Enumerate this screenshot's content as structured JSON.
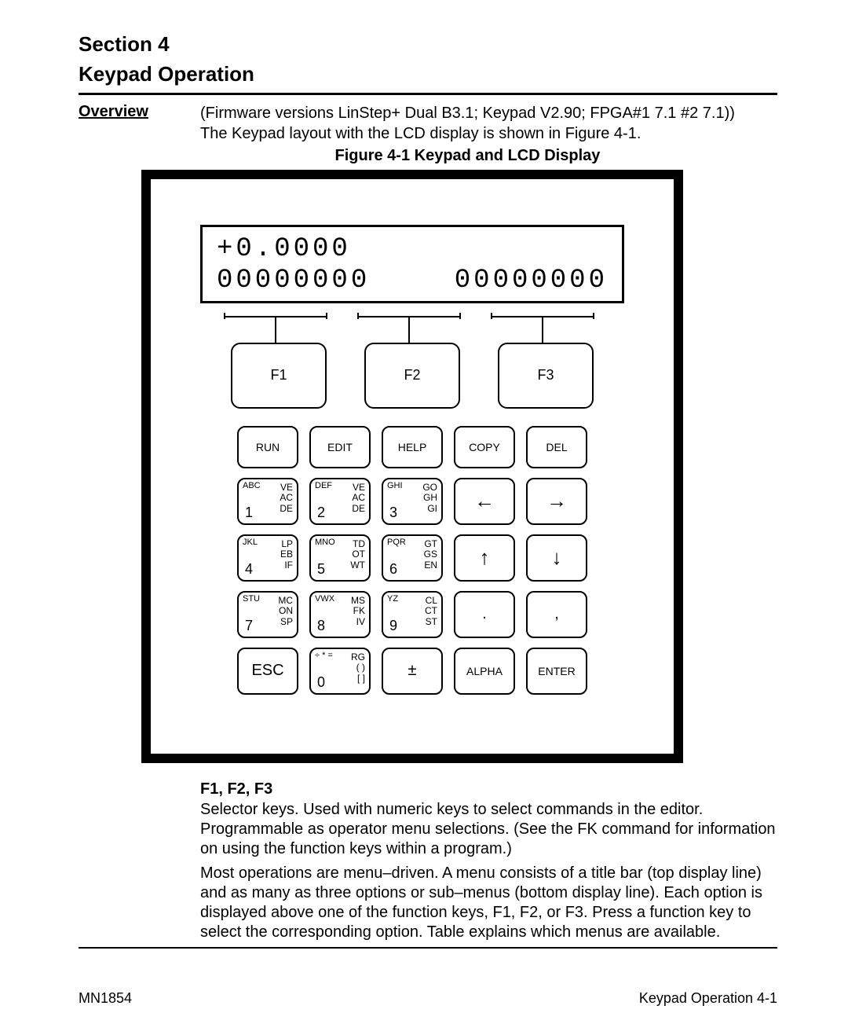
{
  "header": {
    "section_line1": "Section 4",
    "section_line2": "Keypad Operation"
  },
  "overview": {
    "label": "Overview",
    "line1": "(Firmware versions LinStep+ Dual B3.1; Keypad V2.90; FPGA#1 7.1 #2 7.1))",
    "line2": "The Keypad layout with the LCD display is shown in Figure 4-1.",
    "caption": "Figure 4-1  Keypad and LCD Display"
  },
  "lcd": {
    "line1": "+0.0000",
    "l2a": "00000000",
    "l2b": "00000000"
  },
  "fkeys": {
    "f1": "F1",
    "f2": "F2",
    "f3": "F3"
  },
  "row1": {
    "run": "RUN",
    "edit": "EDIT",
    "help": "HELP",
    "copy": "COPY",
    "del": "DEL"
  },
  "num": {
    "1": {
      "tl": "ABC",
      "bl": "1",
      "r1": "VE",
      "r2": "AC",
      "r3": "DE"
    },
    "2": {
      "tl": "DEF",
      "bl": "2",
      "r1": "VE",
      "r2": "AC",
      "r3": "DE"
    },
    "3": {
      "tl": "GHI",
      "bl": "3",
      "r1": "GO",
      "r2": "GH",
      "r3": "GI"
    },
    "4": {
      "tl": "JKL",
      "bl": "4",
      "r1": "LP",
      "r2": "EB",
      "r3": "IF"
    },
    "5": {
      "tl": "MNO",
      "bl": "5",
      "r1": "TD",
      "r2": "OT",
      "r3": "WT"
    },
    "6": {
      "tl": "PQR",
      "bl": "6",
      "r1": "GT",
      "r2": "GS",
      "r3": "EN"
    },
    "7": {
      "tl": "STU",
      "bl": "7",
      "r1": "MC",
      "r2": "ON",
      "r3": "SP"
    },
    "8": {
      "tl": "VWX",
      "bl": "8",
      "r1": "MS",
      "r2": "FK",
      "r3": "IV"
    },
    "9": {
      "tl": "YZ",
      "bl": "9",
      "r1": "CL",
      "r2": "CT",
      "r3": "ST"
    },
    "0": {
      "tl": "÷ * =",
      "bl": "0",
      "r1": "RG",
      "r2": "( )",
      "r3": "[ ]"
    }
  },
  "sym": {
    "left": "←",
    "right": "→",
    "up": "↑",
    "down": "↓",
    "dot": ".",
    "comma": ",",
    "pm": "±",
    "esc": "ESC",
    "alpha": "ALPHA",
    "enter": "ENTER"
  },
  "desc": {
    "head": "F1, F2, F3",
    "p1": "Selector keys. Used with numeric keys to select commands in the editor. Programmable as operator menu selections. (See the FK command for information on using the function keys within a program.)",
    "p2": "Most operations are menu–driven. A menu consists of a title bar (top display line) and as many as three options or sub–menus (bottom display line). Each option is displayed above one of the function keys, F1, F2, or F3. Press a function key to select the corresponding option.  Table explains which menus are available."
  },
  "footer": {
    "left": "MN1854",
    "right": "Keypad Operation  4-1"
  }
}
